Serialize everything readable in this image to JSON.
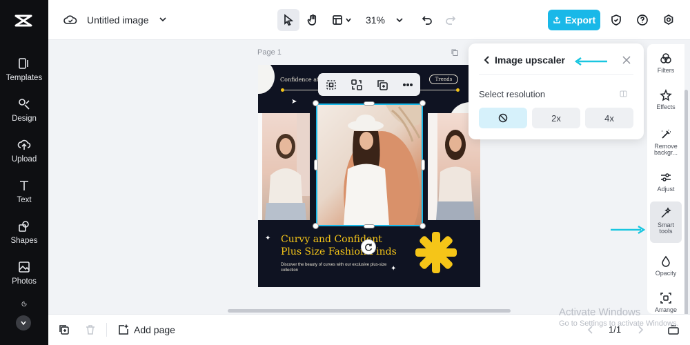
{
  "leftnav": {
    "items": [
      {
        "label": "Templates",
        "icon": "templates-icon"
      },
      {
        "label": "Design",
        "icon": "design-icon"
      },
      {
        "label": "Upload",
        "icon": "upload-icon"
      },
      {
        "label": "Text",
        "icon": "text-icon"
      },
      {
        "label": "Shapes",
        "icon": "shapes-icon"
      },
      {
        "label": "Photos",
        "icon": "photos-icon"
      }
    ]
  },
  "topbar": {
    "doc_title": "Untitled image",
    "zoom": "31%",
    "export_label": "Export"
  },
  "canvas": {
    "page_label": "Page 1",
    "design": {
      "tagline": "Confidence at a",
      "pill": "Trends",
      "headline_1": "Curvy and Confident",
      "headline_2": "Plus Size Fashion Finds",
      "subline": "Discover the beauty of curves with our exclusive plus-size collection"
    }
  },
  "popup": {
    "title": "Image upscaler",
    "resolution_label": "Select resolution",
    "options": [
      "",
      "2x",
      "4x"
    ],
    "selected_index": 0
  },
  "rightpanel": {
    "items": [
      {
        "label": "Filters",
        "icon": "filters-icon"
      },
      {
        "label": "Effects",
        "icon": "effects-icon"
      },
      {
        "label": "Remove backgr...",
        "icon": "remove-background-icon"
      },
      {
        "label": "Adjust",
        "icon": "adjust-icon"
      },
      {
        "label": "Smart tools",
        "icon": "smart-tools-icon"
      },
      {
        "label": "Opacity",
        "icon": "opacity-icon"
      },
      {
        "label": "Arrange",
        "icon": "arrange-icon"
      }
    ],
    "active_index": 4
  },
  "bottombar": {
    "add_page_label": "Add page",
    "page_count": "1/1"
  },
  "watermark": {
    "line1": "Activate Windows",
    "line2": "Go to Settings to activate Windows."
  },
  "colors": {
    "accent": "#19b8e8",
    "nav_bg": "#0e0f12",
    "design_bg": "#0f1322",
    "design_yellow": "#f5c518"
  }
}
